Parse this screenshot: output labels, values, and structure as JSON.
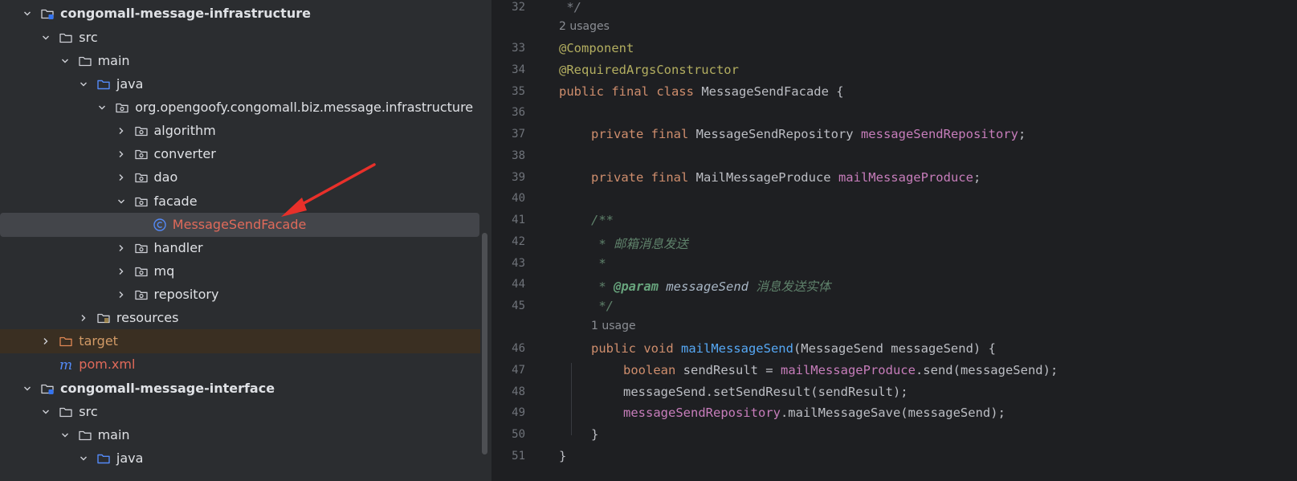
{
  "tree": {
    "items": [
      {
        "label": "congomall-message-infrastructure",
        "icon": "module-folder-icon",
        "chevron": "down",
        "bold": true
      },
      {
        "label": "src",
        "icon": "folder-icon",
        "chevron": "down"
      },
      {
        "label": "main",
        "icon": "folder-icon",
        "chevron": "down"
      },
      {
        "label": "java",
        "icon": "source-folder-icon",
        "chevron": "down"
      },
      {
        "label": "org.opengoofy.congomall.biz.message.infrastructure",
        "icon": "package-icon",
        "chevron": "down"
      },
      {
        "label": "algorithm",
        "icon": "package-icon",
        "chevron": "right"
      },
      {
        "label": "converter",
        "icon": "package-icon",
        "chevron": "right"
      },
      {
        "label": "dao",
        "icon": "package-icon",
        "chevron": "right"
      },
      {
        "label": "facade",
        "icon": "package-icon",
        "chevron": "down"
      },
      {
        "label": "MessageSendFacade",
        "icon": "class-icon",
        "chevron": "none",
        "selected": true
      },
      {
        "label": "handler",
        "icon": "package-icon",
        "chevron": "right"
      },
      {
        "label": "mq",
        "icon": "package-icon",
        "chevron": "right"
      },
      {
        "label": "repository",
        "icon": "package-icon",
        "chevron": "right"
      },
      {
        "label": "resources",
        "icon": "resources-folder-icon",
        "chevron": "right"
      },
      {
        "label": "target",
        "icon": "excluded-folder-icon",
        "chevron": "right",
        "excluded": true
      },
      {
        "label": "pom.xml",
        "icon": "maven-icon",
        "chevron": "none"
      },
      {
        "label": "congomall-message-interface",
        "icon": "module-folder-icon",
        "chevron": "down",
        "bold": true
      },
      {
        "label": "src",
        "icon": "folder-icon",
        "chevron": "down"
      },
      {
        "label": "main",
        "icon": "folder-icon",
        "chevron": "down"
      },
      {
        "label": "java",
        "icon": "source-folder-icon",
        "chevron": "down"
      }
    ]
  },
  "editor": {
    "usages_top": "2 usages",
    "usages_method": "1 usage",
    "line_numbers": [
      "32",
      "33",
      "34",
      "35",
      "36",
      "37",
      "38",
      "39",
      "40",
      "41",
      "42",
      "43",
      "44",
      "45",
      "46",
      "47",
      "48",
      "49",
      "50",
      "51"
    ],
    "code": {
      "l32": " */",
      "l33": "@Component",
      "l34": "@RequiredArgsConstructor",
      "l35_kw": "public final class",
      "l35_name": " MessageSendFacade {",
      "l37_kw": "private final",
      "l37_type": " MessageSendRepository ",
      "l37_field": "messageSendRepository",
      "l37_end": ";",
      "l39_kw": "private final",
      "l39_type": " MailMessageProduce ",
      "l39_field": "mailMessageProduce",
      "l39_end": ";",
      "l41": "/**",
      "l42": " * 邮箱消息发送",
      "l43": " *",
      "l44_star": " * ",
      "l44_tag": "@param",
      "l44_param": " messageSend",
      "l44_desc": " 消息发送实体",
      "l45": " */",
      "l46_kw": "public void",
      "l46_method": " mailMessageSend",
      "l46_rest": "(MessageSend messageSend) {",
      "l47_kw": "boolean",
      "l47_mid": " sendResult = ",
      "l47_field": "mailMessageProduce",
      "l47_rest": ".send(messageSend);",
      "l48": "messageSend.setSendResult(sendResult);",
      "l49_field": "messageSendRepository",
      "l49_rest": ".mailMessageSave(messageSend);",
      "l50": "}",
      "l51": "}"
    }
  },
  "colors": {
    "accent_arrow": "#e8302a",
    "keyword": "#cf8e6d",
    "annotation": "#b3ae60",
    "field": "#c77dbb",
    "method": "#56a8f5"
  }
}
